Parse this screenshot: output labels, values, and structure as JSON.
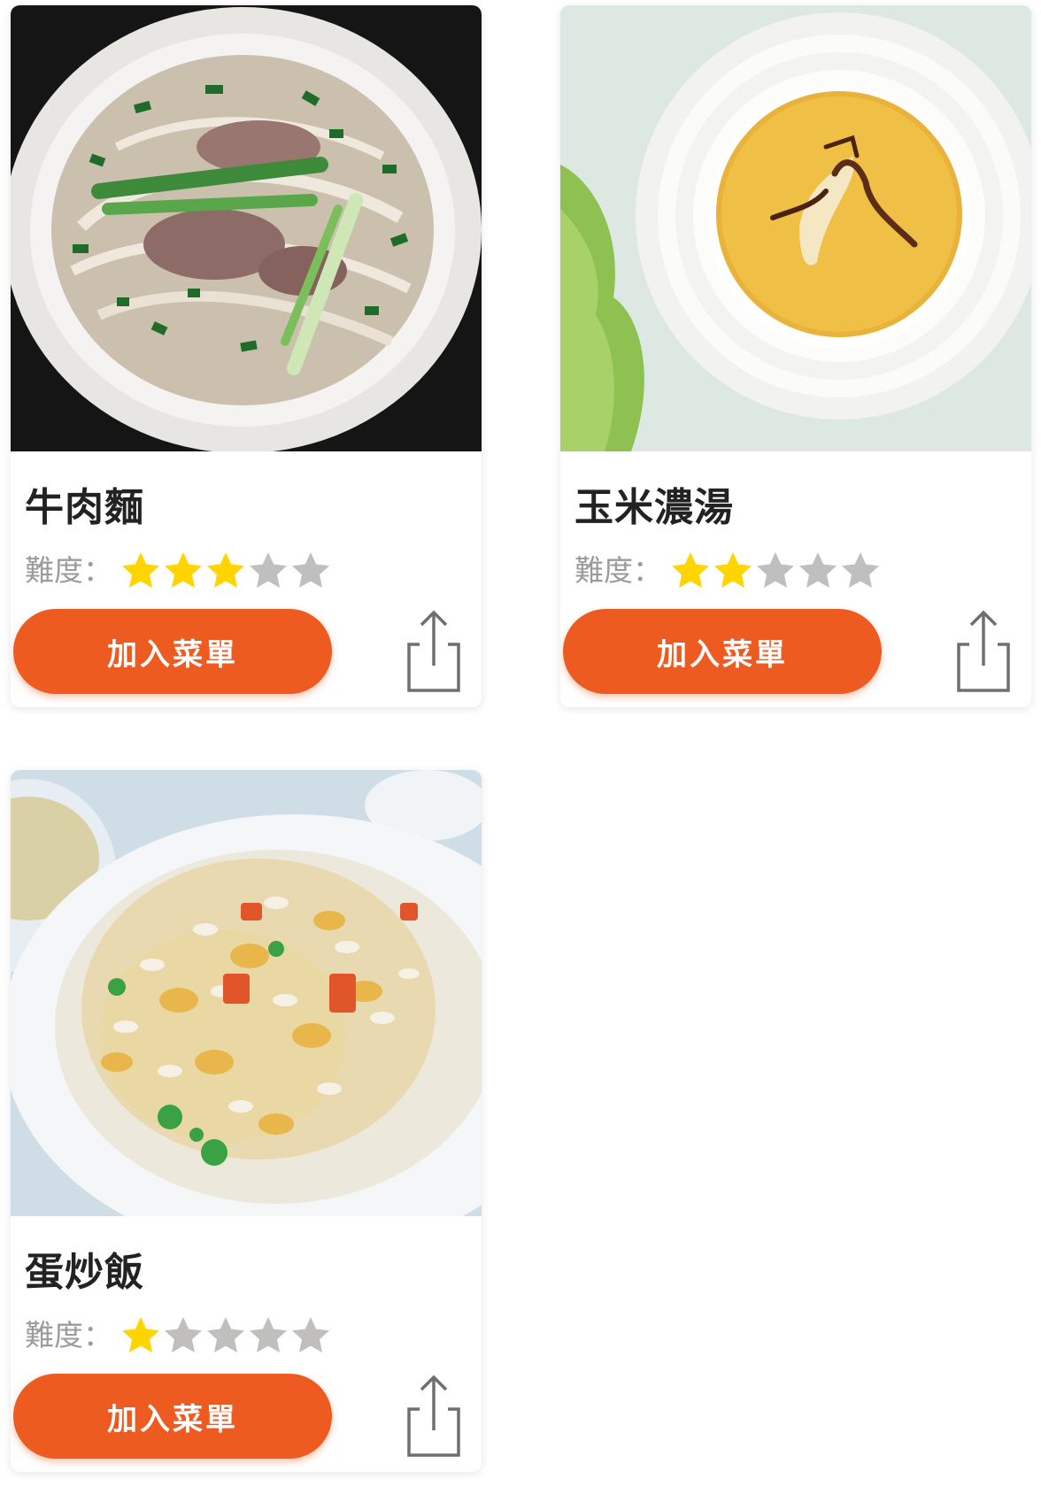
{
  "difficulty_label": "難度：",
  "add_button_label": "加入菜單",
  "colors": {
    "accent": "#ee5b20",
    "star_filled": "#ffd400",
    "star_empty": "#c0bfbd",
    "icon_stroke": "#6f6f6f"
  },
  "cards": [
    {
      "name": "牛肉麵",
      "difficulty": 3,
      "max_difficulty": 5,
      "image": "beef-noodle-soup-photo"
    },
    {
      "name": "玉米濃湯",
      "difficulty": 2,
      "max_difficulty": 5,
      "image": "corn-soup-photo"
    },
    {
      "name": "蛋炒飯",
      "difficulty": 1,
      "max_difficulty": 5,
      "image": "egg-fried-rice-photo"
    }
  ]
}
